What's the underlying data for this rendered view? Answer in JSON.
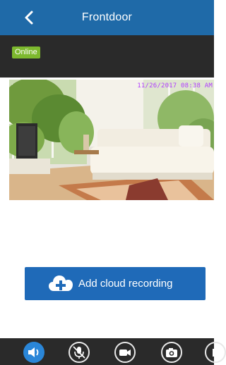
{
  "header": {
    "back_icon": "chevron-left-icon",
    "title": "Frontdoor"
  },
  "status": {
    "badge": "Online",
    "badge_color": "#7db92e"
  },
  "video": {
    "timestamp": "11/26/2017 08:38 AM"
  },
  "cloud_recording": {
    "icon": "cloud-plus-icon",
    "label": "Add cloud recording"
  },
  "toolbar": {
    "items": [
      {
        "name": "speaker-icon",
        "active": true
      },
      {
        "name": "microphone-muted-icon",
        "active": false
      },
      {
        "name": "video-record-icon",
        "active": false
      },
      {
        "name": "camera-snapshot-icon",
        "active": false
      },
      {
        "name": "more-icon",
        "active": false
      }
    ],
    "active_color": "#2a86d8"
  },
  "colors": {
    "header": "#1f6aa8",
    "dark_bar": "#2a2a2a",
    "button": "#1f6ab8"
  }
}
